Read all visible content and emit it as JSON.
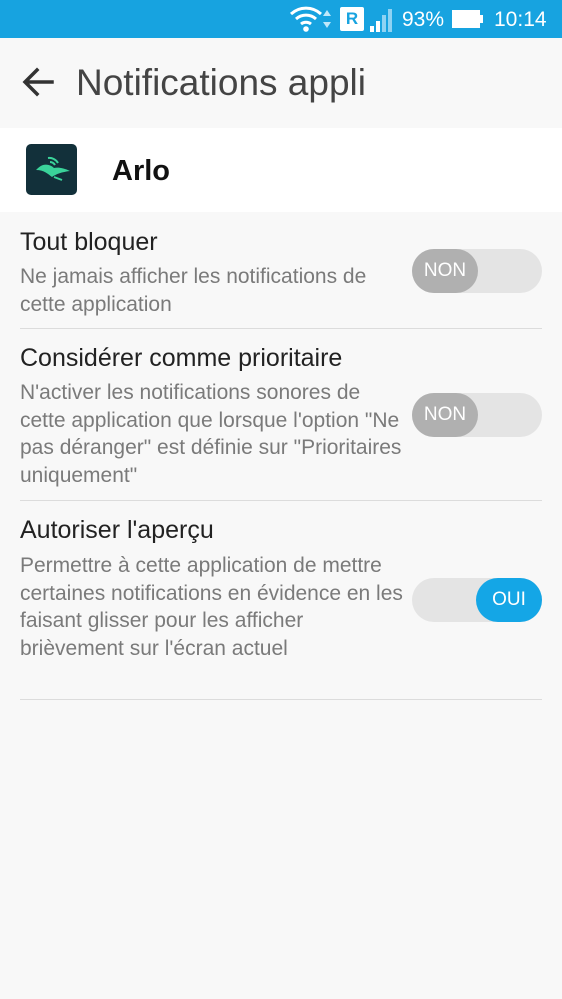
{
  "status_bar": {
    "roaming_letter": "R",
    "battery_percent": "93%",
    "time": "10:14",
    "icons": [
      "wifi-icon",
      "data-arrows-icon",
      "roaming-icon",
      "signal-icon",
      "battery-icon"
    ]
  },
  "header": {
    "title": "Notifications appli"
  },
  "app": {
    "name": "Arlo",
    "icon": "arlo-bird-icon"
  },
  "settings": [
    {
      "title": "Tout bloquer",
      "description": "Ne jamais afficher les notifications de cette application",
      "toggle_label": "NON",
      "enabled": false
    },
    {
      "title": "Considérer comme prioritaire",
      "description": "N'activer les notifications sonores de cette application que lorsque l'option \"Ne pas déranger\" est définie sur \"Prioritaires uniquement\"",
      "toggle_label": "NON",
      "enabled": false
    },
    {
      "title": "Autoriser l'aperçu",
      "description": "Permettre à cette application de mettre certaines notifications en évidence en les faisant glisser pour les afficher brièvement sur l'écran actuel",
      "toggle_label": "OUI",
      "enabled": true
    }
  ],
  "colors": {
    "status_bar": "#17a3e0",
    "toggle_on": "#14a6e6",
    "toggle_off_knob": "#b0b0b0",
    "app_icon_bg": "#12303a",
    "app_icon_accent": "#3ad39a"
  }
}
